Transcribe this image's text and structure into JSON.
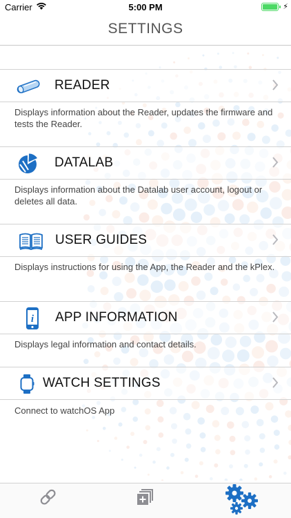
{
  "status_bar": {
    "carrier": "Carrier",
    "time": "5:00 PM",
    "battery_percent": 100
  },
  "nav": {
    "title": "SETTINGS"
  },
  "settings": [
    {
      "label": "READER",
      "icon": "reader-device-icon",
      "description": "Displays information about the Reader, updates the firmware and tests the Reader."
    },
    {
      "label": "DATALAB",
      "icon": "datalab-pie-icon",
      "description": "Displays information about the Datalab user account, logout or deletes all data."
    },
    {
      "label": "USER GUIDES",
      "icon": "open-book-icon",
      "description": "Displays instructions for using the App, the Reader and the kPlex."
    },
    {
      "label": "APP INFORMATION",
      "icon": "phone-info-icon",
      "description": "Displays legal information and contact details."
    },
    {
      "label": "WATCH SETTINGS",
      "icon": "watch-icon",
      "description": "Connect to watchOS App"
    }
  ],
  "tab_bar": {
    "tabs": [
      {
        "icon": "link-icon",
        "selected": false
      },
      {
        "icon": "add-stack-icon",
        "selected": false
      },
      {
        "icon": "gears-icon",
        "selected": true
      }
    ]
  },
  "colors": {
    "accent_blue": "#1d6fc4",
    "icon_gray": "#8e8e93",
    "battery_green": "#4cd964"
  }
}
